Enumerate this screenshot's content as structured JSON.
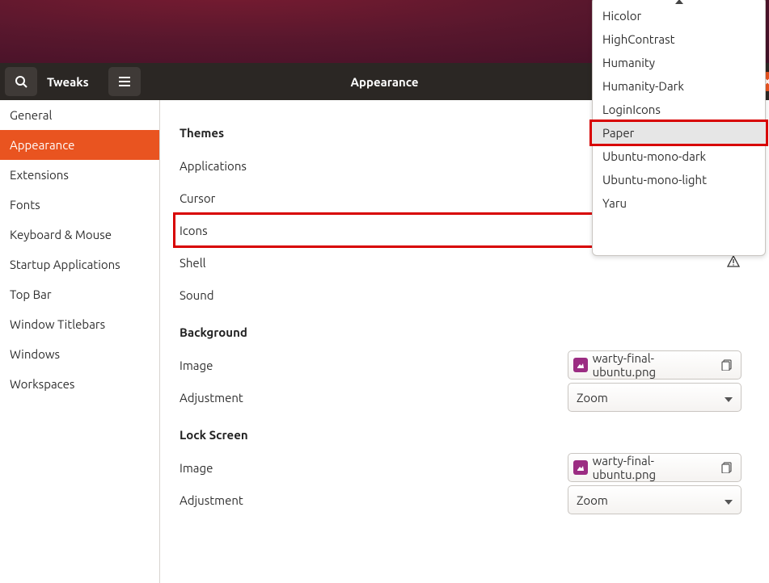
{
  "window": {
    "title_left": "Tweaks",
    "title_center": "Appearance"
  },
  "sidebar": {
    "items": [
      {
        "label": "General"
      },
      {
        "label": "Appearance"
      },
      {
        "label": "Extensions"
      },
      {
        "label": "Fonts"
      },
      {
        "label": "Keyboard & Mouse"
      },
      {
        "label": "Startup Applications"
      },
      {
        "label": "Top Bar"
      },
      {
        "label": "Window Titlebars"
      },
      {
        "label": "Windows"
      },
      {
        "label": "Workspaces"
      }
    ],
    "active_index": 1
  },
  "themes": {
    "section": "Themes",
    "applications_label": "Applications",
    "cursor_label": "Cursor",
    "icons_label": "Icons",
    "shell_label": "Shell",
    "sound_label": "Sound"
  },
  "icons_dropdown": {
    "options": [
      "Hicolor",
      "HighContrast",
      "Humanity",
      "Humanity-Dark",
      "LoginIcons",
      "Paper",
      "Ubuntu-mono-dark",
      "Ubuntu-mono-light",
      "Yaru"
    ],
    "hover_index": 5
  },
  "background": {
    "section": "Background",
    "image_label": "Image",
    "image_value": "warty-final-ubuntu.png",
    "adjustment_label": "Adjustment",
    "adjustment_value": "Zoom"
  },
  "lockscreen": {
    "section": "Lock Screen",
    "image_label": "Image",
    "image_value": "warty-final-ubuntu.png",
    "adjustment_label": "Adjustment",
    "adjustment_value": "Zoom"
  }
}
